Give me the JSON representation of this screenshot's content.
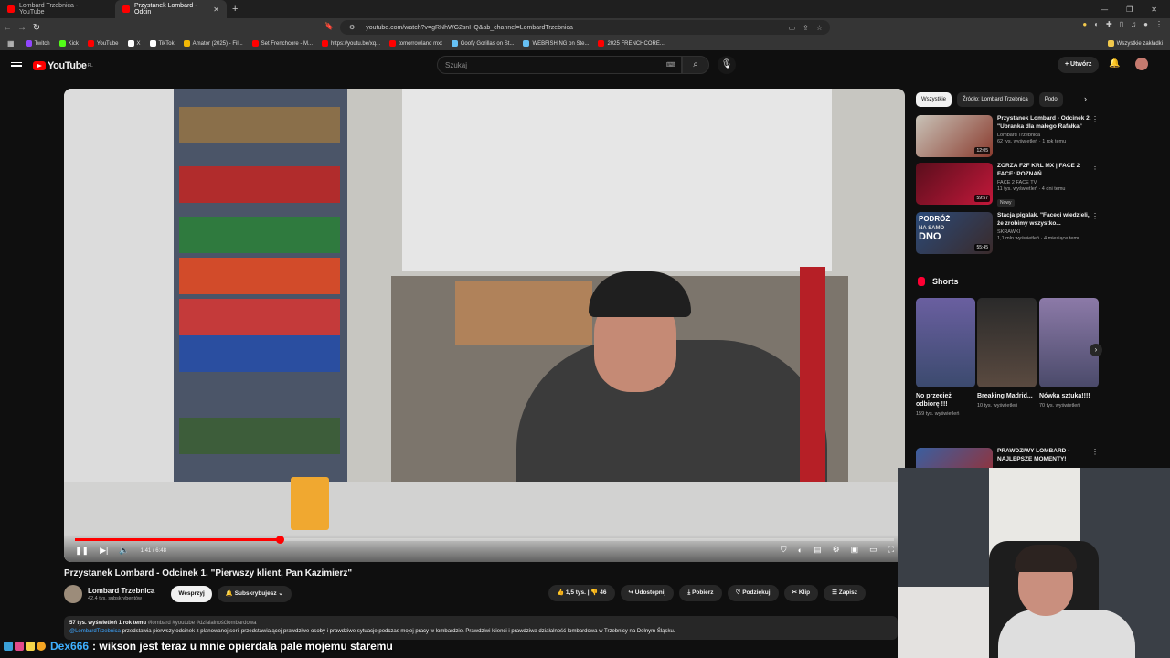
{
  "browser": {
    "tabs": [
      {
        "title": "Lombard Trzebnica - YouTube",
        "active": false
      },
      {
        "title": "Przystanek Lombard - Odcin",
        "active": true
      }
    ],
    "url": "youtube.com/watch?v=gRNhWG2snHQ&ab_channel=LombardTrzebnica",
    "bookmarks": [
      {
        "label": "Twitch",
        "color": "#9146ff"
      },
      {
        "label": "Kick",
        "color": "#53fc18"
      },
      {
        "label": "YouTube",
        "color": "#ff0000"
      },
      {
        "label": "X",
        "color": "#ffffff"
      },
      {
        "label": "TikTok",
        "color": "#ffffff"
      },
      {
        "label": "Amator (2025) - Fil...",
        "color": "#f2b705"
      },
      {
        "label": "Set Frenchcore - M...",
        "color": "#ff0000"
      },
      {
        "label": "https://youtu.be/xq...",
        "color": "#ff0000"
      },
      {
        "label": "tomorrowland mxt",
        "color": "#ff0000"
      },
      {
        "label": "Goofy Gorillas on St...",
        "color": "#1b2838"
      },
      {
        "label": "WEBFISHING on Ste...",
        "color": "#1b2838"
      },
      {
        "label": "2025 FRENCHCORE...",
        "color": "#ff0000"
      }
    ],
    "all_bookmarks": "Wszystkie zakładki"
  },
  "youtube": {
    "logo_text": "YouTube",
    "logo_region": "PL",
    "search_placeholder": "Szukaj",
    "create_label": "Utwórz"
  },
  "video": {
    "progress": 0.25,
    "timecode": "1:41 / 6:48",
    "title": "Przystanek Lombard - Odcinek 1. \"Pierwszy klient, Pan Kazimierz\"",
    "channel": "Lombard Trzebnica",
    "subscribers": "42,4 tys. subskrybentów",
    "support_label": "Wesprzyj",
    "subscribed_label": "Subskrybujesz",
    "likes": "1,5 tys.",
    "comments": "46",
    "share_label": "Udostępnij",
    "download_label": "Pobierz",
    "thanks_label": "Podziękuj",
    "clip_label": "Klip",
    "save_label": "Zapisz",
    "description_meta": "57 tys. wyświetleń  1 rok temu",
    "description_tags": "#lombard #youtube #dzialalnośćlombardowa",
    "description_mention": "@LombardTrzebnica",
    "description_text": " przedstawia pierwszy odcinek z planowanej serii przedstawiającej prawdziwe osoby i prawdziwe sytuacje podczas mojej pracy w lombardzie. Prawdziwi klienci i prawdziwa działalność lombardowa w Trzebnicy na Dolnym Śląsku."
  },
  "sidebar": {
    "chips": [
      "Wszystkie",
      "Źródło: Lombard Trzebnica",
      "Podo"
    ],
    "recommendations": [
      {
        "title": "Przystanek Lombard - Odcinek 2. \"Ubranka dla małego Rafałka\"",
        "channel": "Lombard Trzebnica",
        "stats": "62 tys. wyświetleń · 1 rok temu",
        "duration": "12:05",
        "badge": ""
      },
      {
        "title": "ZORZA F2F KRL MX | FACE 2 FACE: POZNAŃ",
        "channel": "FACE 2 FACE TV",
        "stats": "11 tys. wyświetleń · 4 dni temu",
        "duration": "59:57",
        "badge": "Nowy"
      },
      {
        "title": "Stacja pigalak. \"Faceci wiedzieli, że zrobimy wszystko...",
        "channel": "SKRAWKI",
        "stats": "1,1 mln wyświetleń · 4 miesiące temu",
        "duration": "55:45",
        "badge": ""
      },
      {
        "title": "PRAWDZIWY LOMBARD - NAJLEPSZE MOMENTY!",
        "channel": "",
        "stats": "",
        "duration": "",
        "badge": ""
      }
    ],
    "thumb3_caption_top": "PODRÓŻ",
    "thumb3_caption_mid": "NA SAMO",
    "thumb3_caption_bottom": "DNO",
    "shorts_title": "Shorts",
    "shorts": [
      {
        "title": "No przecież odbiorę !!!",
        "views": "159 tys. wyświetleń"
      },
      {
        "title": "Breaking Madrid...",
        "views": "10 tys. wyświetleń"
      },
      {
        "title": "Nówka sztuka!!!!",
        "views": "70 tys. wyświetleń"
      }
    ]
  },
  "chat": {
    "user": "Dex666",
    "message": ": wikson jest teraz u mnie opierdala pale mojemu staremu"
  }
}
